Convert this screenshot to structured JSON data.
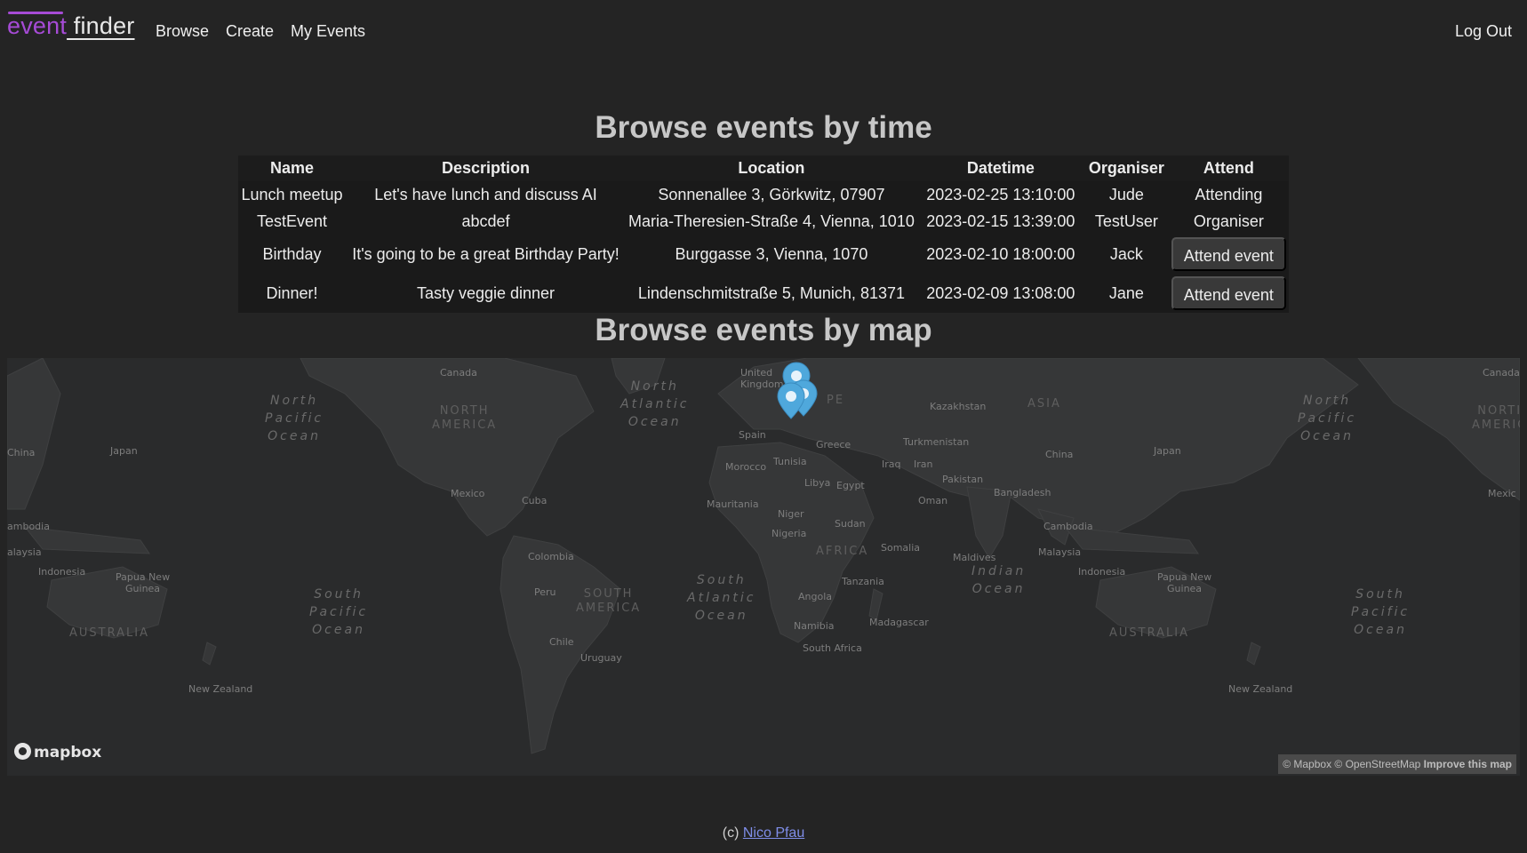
{
  "nav": {
    "brand_part1": "event",
    "brand_part2": " finder",
    "browse": "Browse",
    "create": "Create",
    "my_events": "My Events",
    "log_out": "Log Out"
  },
  "headings": {
    "by_time": "Browse events by time",
    "by_map": "Browse events by map"
  },
  "table": {
    "headers": {
      "name": "Name",
      "description": "Description",
      "location": "Location",
      "datetime": "Datetime",
      "organiser": "Organiser",
      "attend": "Attend"
    },
    "rows": [
      {
        "name": "Lunch meetup",
        "description": "Let's have lunch and discuss AI",
        "location": "Sonnenallee 3, Görkwitz, 07907",
        "datetime": "2023-02-25 13:10:00",
        "organiser": "Jude",
        "attend": "Attending"
      },
      {
        "name": "TestEvent",
        "description": "abcdef",
        "location": "Maria-Theresien-Straße 4, Vienna, 1010",
        "datetime": "2023-02-15 13:39:00",
        "organiser": "TestUser",
        "attend": "Organiser"
      },
      {
        "name": "Birthday",
        "description": "It's going to be a great Birthday Party!",
        "location": "Burggasse 3, Vienna, 1070",
        "datetime": "2023-02-10 18:00:00",
        "organiser": "Jack",
        "attend": "Attend event"
      },
      {
        "name": "Dinner!",
        "description": "Tasty veggie dinner",
        "location": "Lindenschmitstraße 5, Munich, 81371",
        "datetime": "2023-02-09 13:08:00",
        "organiser": "Jane",
        "attend": "Attend event"
      }
    ]
  },
  "map": {
    "logo": "mapbox",
    "attribution_text": "© Mapbox © OpenStreetMap ",
    "attribution_improve": "Improve this map",
    "country_labels": {
      "canada_l": "Canada",
      "canada_r": "Canada",
      "united_kingdom": "United\nKingdom",
      "spain": "Spain",
      "tunisia": "Tunisia",
      "morocco": "Morocco",
      "greece": "Greece",
      "libya": "Libya",
      "egypt": "Egypt",
      "mauritania": "Mauritania",
      "niger": "Niger",
      "nigeria": "Nigeria",
      "sudan": "Sudan",
      "somalia": "Somalia",
      "tanzania": "Tanzania",
      "angola": "Angola",
      "namibia": "Namibia",
      "south_africa": "South Africa",
      "madagascar": "Madagascar",
      "kazakhstan": "Kazakhstan",
      "turkmenistan": "Turkmenistan",
      "iraq": "Iraq",
      "iran": "Iran",
      "pakistan": "Pakistan",
      "oman": "Oman",
      "china_m": "China",
      "china_l": "China",
      "japan_l": "Japan",
      "japan_m": "Japan",
      "bangladesh": "Bangladesh",
      "maldives": "Maldives",
      "cambodia_m": "Cambodia",
      "cambodia_l": "ambodia",
      "malaysia_m": "Malaysia",
      "malaysia_l": "alaysia",
      "indonesia_l": "Indonesia",
      "indonesia_m": "Indonesia",
      "png_l": "Papua New\nGuinea",
      "png_m": "Papua New\nGuinea",
      "mexico_l": "Mexico",
      "mexico_r": "Mexic",
      "cuba": "Cuba",
      "colombia": "Colombia",
      "peru": "Peru",
      "chile": "Chile",
      "uruguay": "Uruguay",
      "new_zealand_l": "New Zealand",
      "new_zealand_r": "New Zealand"
    },
    "oceans": {
      "north_pacific_l": "North\nPacific\nOcean",
      "north_pacific_r": "North\nPacific\nOcean",
      "north_atlantic": "North\nAtlantic\nOcean",
      "south_pacific_l": "South\nPacific\nOcean",
      "south_pacific_r": "South\nPacific\nOcean",
      "south_atlantic": "South\nAtlantic\nOcean",
      "indian": "Indian\nOcean"
    },
    "continents": {
      "north_america_l": "NORTH\nAMERICA",
      "north_america_r": "NORTI\nAMERIC",
      "south_america": "SOUTH\nAMERICA",
      "africa": "AFRICA",
      "asia": "ASIA",
      "australia_l": "AUSTRALIA",
      "australia_r": "AUSTRALIA",
      "europe_partial": "PE"
    },
    "marker_color": "#4fa8dc"
  },
  "footer": {
    "prefix": "(c) ",
    "author": "Nico Pfau"
  }
}
